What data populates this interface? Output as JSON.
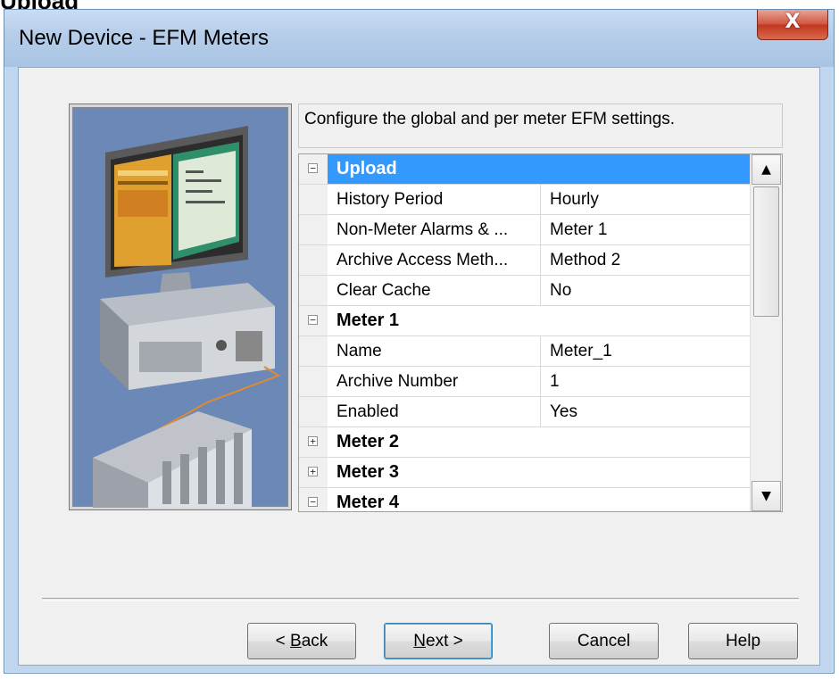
{
  "page_heading": "Upload",
  "window": {
    "title": "New Device - EFM Meters",
    "close_glyph": "X"
  },
  "description": "Configure the global and per meter EFM settings.",
  "property_grid": {
    "upload": {
      "label": "Upload",
      "expander": "−",
      "properties": [
        {
          "name": "History Period",
          "value": "Hourly"
        },
        {
          "name": "Non-Meter Alarms & ...",
          "value": "Meter 1"
        },
        {
          "name": "Archive Access Meth...",
          "value": "Method 2"
        },
        {
          "name": "Clear Cache",
          "value": "No"
        }
      ]
    },
    "meter1": {
      "label": "Meter 1",
      "expander": "−",
      "properties": [
        {
          "name": "Name",
          "value": "Meter_1"
        },
        {
          "name": "Archive Number",
          "value": "1"
        },
        {
          "name": "Enabled",
          "value": "Yes"
        }
      ]
    },
    "meter2": {
      "label": "Meter 2",
      "expander": "+"
    },
    "meter3": {
      "label": "Meter 3",
      "expander": "+"
    },
    "meter4": {
      "label": "Meter 4",
      "expander": "−"
    },
    "scroll_up_glyph": "▲",
    "scroll_down_glyph": "▼"
  },
  "buttons": {
    "back_prefix": "< ",
    "back_accel": "B",
    "back_rest": "ack",
    "next_accel": "N",
    "next_rest": "ext >",
    "cancel": "Cancel",
    "help": "Help"
  },
  "icons": {
    "close": "close-icon",
    "wizard": "computer-network-illustration"
  },
  "colors": {
    "selection": "#3399ff",
    "titlebar": "#b5cde9",
    "close_button": "#c2371f"
  }
}
